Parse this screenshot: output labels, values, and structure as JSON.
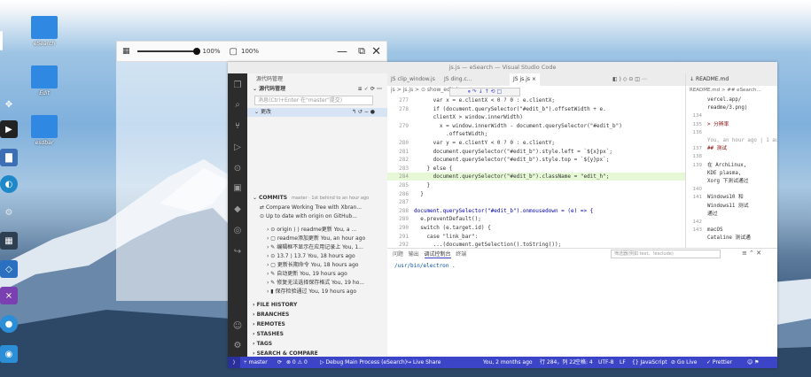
{
  "desktop": {
    "icons": [
      {
        "label": "eSearch"
      },
      {
        "label": "Edit"
      },
      {
        "label": "esdbar"
      }
    ]
  },
  "viewer": {
    "zoom_left": "100%",
    "zoom_right": "100%"
  },
  "vscode": {
    "title": "js.js — eSearch — Visual Studio Code",
    "source_control": {
      "header": "源代码管理",
      "section": "源代码管理",
      "message_placeholder": "消息(Ctrl+Enter 在\"master\"提交)",
      "changes_label": "更改",
      "commits_label": "COMMITS",
      "commits_meta": "master · 1st behind to an hour ago",
      "commit_items": [
        "Compare Working Tree with Xbran...",
        "Up to date with origin on GitHub..."
      ],
      "history": [
        "origin  ⟩ ⟩ readme更新  You, a ...",
        "readme添加更新  You, an hour ago",
        "编辑框不显示在应用记录上  You, 1...",
        "13.7  ⟩  13.7  You, 18 hours ago",
        "更新长期命令  You, 18 hours ago",
        "自动更新  You, 19 hours ago",
        "修复无法选择保存格式  You, 19 ho...",
        "保存检验通过  You, 19 hours ago"
      ],
      "sections": [
        "FILE HISTORY",
        "BRANCHES",
        "REMOTES",
        "STASHES",
        "TAGS",
        "SEARCH & COMPARE"
      ]
    },
    "tabs": [
      "clip_window.js",
      "ding.c...",
      "js.js",
      "README.md"
    ],
    "breadcrumb": "js > js.js > ⊙ show_edit_bar",
    "lines": [
      {
        "n": "277",
        "t": "      var x = e.clientX < 0 ? 0 : e.clientX;"
      },
      {
        "n": "278",
        "t": "      if (document.querySelector(\"#edit_b\").offsetWidth + e."
      },
      {
        "n": "",
        "t": "      clientX > window.innerWidth)"
      },
      {
        "n": "279",
        "t": "        x = window.innerWidth - document.querySelector(\"#edit_b\")"
      },
      {
        "n": "",
        "t": "          .offsetWidth;"
      },
      {
        "n": "280",
        "t": "      var y = e.clientY < 0 ? 0 : e.clientY;"
      },
      {
        "n": "281",
        "t": "      document.querySelector(\"#edit_b\").style.left = `${x}px`;"
      },
      {
        "n": "282",
        "t": "      document.querySelector(\"#edit_b\").style.top = `${y}px`;"
      },
      {
        "n": "283",
        "t": "    } else {"
      },
      {
        "n": "284",
        "t": "      document.querySelector(\"#edit_b\").className = \"edit_h\";"
      },
      {
        "n": "285",
        "t": "    }"
      },
      {
        "n": "286",
        "t": "  }"
      },
      {
        "n": "287",
        "t": ""
      },
      {
        "n": "288",
        "t": "document.querySelector(\"#edit_b\").onmousedown = (e) => {"
      },
      {
        "n": "289",
        "t": "  e.preventDefault();"
      },
      {
        "n": "290",
        "t": "  switch (e.target.id) {"
      },
      {
        "n": "291",
        "t": "    case \"link_bar\":"
      },
      {
        "n": "292",
        "t": "      ...(document.getSelection().toString());"
      }
    ],
    "panel": {
      "tabs": [
        "问题",
        "输出",
        "调试控制台",
        "终端"
      ],
      "filter_placeholder": "筛选器(例如 text、!exclude)",
      "output": "/usr/bin/electron ."
    },
    "readme": {
      "tab": "README.md",
      "crumb": "README.md > ## eSearch...",
      "lines": [
        {
          "n": "",
          "t": "vercel.app/"
        },
        {
          "n": "",
          "t": "readme/3.png)"
        },
        {
          "n": "134",
          "t": ""
        },
        {
          "n": "135",
          "t": "> 分辨率"
        },
        {
          "n": "136",
          "t": ""
        },
        {
          "n": "",
          "t": "You, an hour ago | 1 aut..."
        },
        {
          "n": "137",
          "t": "## 测试"
        },
        {
          "n": "138",
          "t": ""
        },
        {
          "n": "139",
          "t": "在 ArchLinux,"
        },
        {
          "n": "",
          "t": "KDE plasma,"
        },
        {
          "n": "",
          "t": "Xorg 下测试通过"
        },
        {
          "n": "140",
          "t": ""
        },
        {
          "n": "141",
          "t": "Windows10 和"
        },
        {
          "n": "",
          "t": "Windows11 测试"
        },
        {
          "n": "",
          "t": "通过"
        },
        {
          "n": "142",
          "t": ""
        },
        {
          "n": "143",
          "t": "macOS"
        },
        {
          "n": "",
          "t": "Cataline 测试通"
        }
      ]
    },
    "status": {
      "branch": "master",
      "sync": "⟳",
      "problems": "⊗ 0 ⚠ 0",
      "debug": "Debug Main Process (eSearch)",
      "live_share": "Live Share",
      "blame": "You, 2 months ago",
      "position": "行 284，列 22",
      "indent": "空格: 4",
      "encoding": "UTF-8",
      "eol": "LF",
      "lang": "{} JavaScript",
      "golive": "⊘ Go Live",
      "prettier": "✓ Prettier"
    }
  }
}
